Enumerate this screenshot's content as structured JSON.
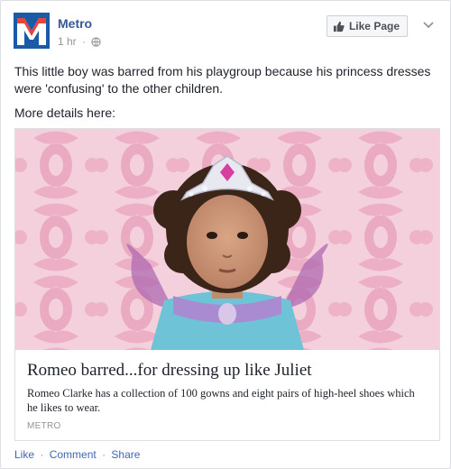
{
  "post": {
    "page_name": "Metro",
    "time": "1 hr",
    "meta_separator": "·",
    "like_page_label": "Like Page",
    "body_lines": [
      "This little boy was barred from his playgroup because his princess dresses were 'confusing' to the other children.",
      "More details here:"
    ],
    "card": {
      "title": "Romeo barred...for dressing up like Juliet",
      "description": "Romeo Clarke has a collection of 100 gowns and eight pairs of high-heel shoes which he likes to wear.",
      "source": "METRO"
    },
    "actions": {
      "like": "Like",
      "comment": "Comment",
      "share": "Share",
      "separator": "·"
    }
  },
  "colors": {
    "link": "#365899",
    "metro_blue": "#1a5aa6",
    "metro_red": "#e2231a",
    "wallpaper": "#f3d0dc",
    "damask": "#e89ab6"
  },
  "icons": [
    "globe-icon",
    "thumbs-up-icon",
    "chevron-down-icon",
    "metro-logo"
  ]
}
